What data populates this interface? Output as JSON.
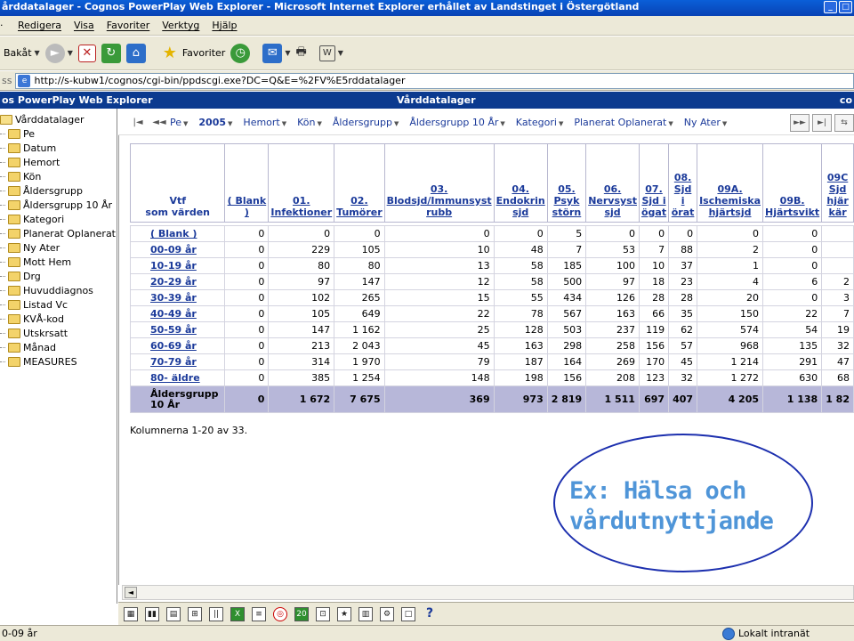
{
  "window": {
    "title": "årddatalager - Cognos PowerPlay Web Explorer - Microsoft Internet Explorer erhållet av Landstinget i Östergötland"
  },
  "menu": [
    "Redigera",
    "Visa",
    "Favoriter",
    "Verktyg",
    "Hjälp"
  ],
  "toolbar": {
    "back_label": "Bakåt",
    "favorites_label": "Favoriter"
  },
  "address": {
    "label": "ss",
    "url": "http://s-kubw1/cognos/cgi-bin/ppdscgi.exe?DC=Q&E=%2FV%E5rddatalager"
  },
  "app": {
    "left_title": "os PowerPlay Web Explorer",
    "center_title": "Vårddatalager",
    "right_title": "co"
  },
  "tree": {
    "root": "Vårddatalager",
    "items": [
      "Pe",
      "Datum",
      "Hemort",
      "Kön",
      "Åldersgrupp",
      "Åldersgrupp 10 År",
      "Kategori",
      "Planerat Oplanerat",
      "Ny Ater",
      "Mott Hem",
      "Drg",
      "Huvuddiagnos",
      "Listad Vc",
      "KVÅ-kod",
      "Utskrsatt",
      "Månad",
      "MEASURES"
    ]
  },
  "dimbar": {
    "first_label": "Pe",
    "year_label": "2005",
    "items": [
      "Hemort",
      "Kön",
      "Åldersgrupp",
      "Åldersgrupp 10 År",
      "Kategori",
      "Planerat Oplanerat",
      "Ny Ater"
    ]
  },
  "table": {
    "corner_line1": "Vtf",
    "corner_line2": "som värden",
    "columns": [
      "( Blank )",
      "01. Infektioner",
      "02. Tumörer",
      "03. Blodsjd/Immunsyst rubb",
      "04. Endokrin sjd",
      "05. Psyk störn",
      "06. Nervsyst sjd",
      "07. Sjd i ögat",
      "08. Sjd i örat",
      "09A. Ischemiska hjärtsjd",
      "09B. Hjärtsvikt",
      "09C Sjd hjär kär"
    ],
    "rows": [
      {
        "label": "( Blank )",
        "values": [
          "0",
          "0",
          "0",
          "0",
          "0",
          "5",
          "0",
          "0",
          "0",
          "0",
          "0",
          ""
        ]
      },
      {
        "label": "00-09 år",
        "values": [
          "0",
          "229",
          "105",
          "10",
          "48",
          "7",
          "53",
          "7",
          "88",
          "2",
          "0",
          ""
        ]
      },
      {
        "label": "10-19 år",
        "values": [
          "0",
          "80",
          "80",
          "13",
          "58",
          "185",
          "100",
          "10",
          "37",
          "1",
          "0",
          ""
        ]
      },
      {
        "label": "20-29 år",
        "values": [
          "0",
          "97",
          "147",
          "12",
          "58",
          "500",
          "97",
          "18",
          "23",
          "4",
          "6",
          "2"
        ]
      },
      {
        "label": "30-39 år",
        "values": [
          "0",
          "102",
          "265",
          "15",
          "55",
          "434",
          "126",
          "28",
          "28",
          "20",
          "0",
          "3"
        ]
      },
      {
        "label": "40-49 år",
        "values": [
          "0",
          "105",
          "649",
          "22",
          "78",
          "567",
          "163",
          "66",
          "35",
          "150",
          "22",
          "7"
        ]
      },
      {
        "label": "50-59 år",
        "values": [
          "0",
          "147",
          "1 162",
          "25",
          "128",
          "503",
          "237",
          "119",
          "62",
          "574",
          "54",
          "19"
        ]
      },
      {
        "label": "60-69 år",
        "values": [
          "0",
          "213",
          "2 043",
          "45",
          "163",
          "298",
          "258",
          "156",
          "57",
          "968",
          "135",
          "32"
        ]
      },
      {
        "label": "70-79 år",
        "values": [
          "0",
          "314",
          "1 970",
          "79",
          "187",
          "164",
          "269",
          "170",
          "45",
          "1 214",
          "291",
          "47"
        ]
      },
      {
        "label": "80- äldre",
        "values": [
          "0",
          "385",
          "1 254",
          "148",
          "198",
          "156",
          "208",
          "123",
          "32",
          "1 272",
          "630",
          "68"
        ]
      }
    ],
    "total": {
      "label_line1": "Åldersgrupp",
      "label_line2": "10 År",
      "values": [
        "0",
        "1 672",
        "7 675",
        "369",
        "973",
        "2 819",
        "1 511",
        "697",
        "407",
        "4 205",
        "1 138",
        "1 82"
      ]
    }
  },
  "column_note": "Kolumnerna 1-20 av 33.",
  "annotation": {
    "line1": "Ex: Hälsa och",
    "line2": "vårdutnyttjande"
  },
  "status": {
    "left": "0-09 år",
    "zone": "Lokalt intranät"
  }
}
